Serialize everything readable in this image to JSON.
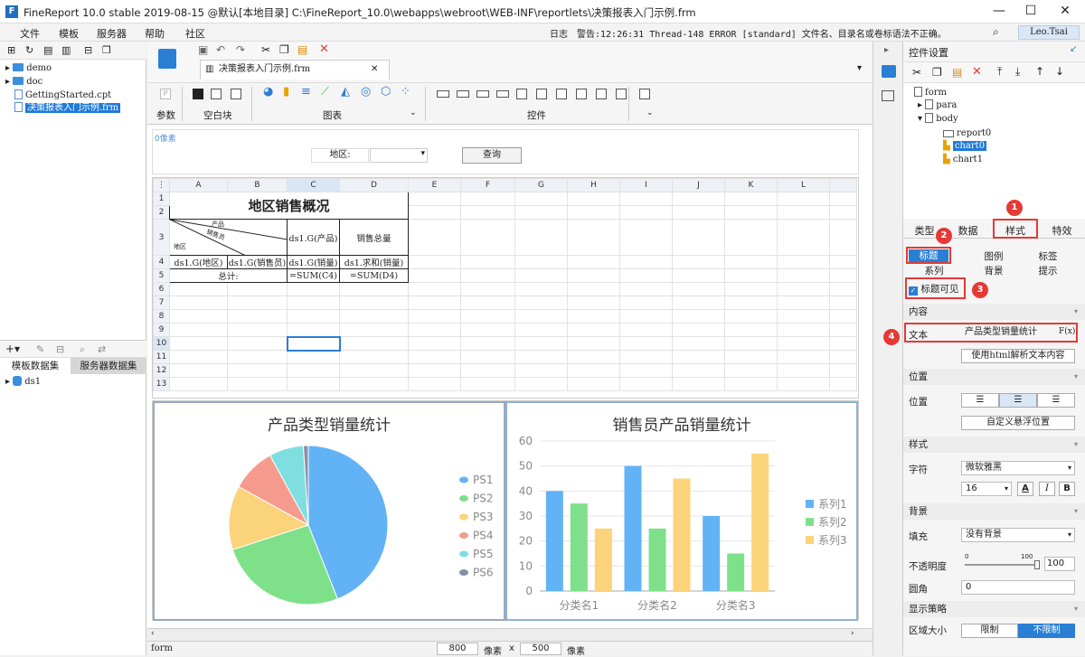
{
  "window": {
    "title": "FineReport 10.0 stable 2019-08-15 @默认[本地目录]     C:\\FineReport_10.0\\webapps\\webroot\\WEB-INF\\reportlets\\决策报表入门示例.frm",
    "minimize": "—",
    "maximize": "☐",
    "close": "✕"
  },
  "menu": {
    "items": [
      "文件",
      "模板",
      "服务器",
      "帮助",
      "社区"
    ],
    "log_label": "日志",
    "log_message": "警告:12:26:31 Thread-148 ERROR [standard] 文件名、目录名或卷标语法不正确。",
    "user": "Leo.Tsai"
  },
  "file_tree": {
    "items": [
      "demo",
      "doc",
      "GettingStarted.cpt",
      "决策报表入门示例.frm"
    ]
  },
  "datasets": {
    "tabs": [
      "模板数据集",
      "服务器数据集"
    ],
    "items": [
      "ds1"
    ]
  },
  "editor": {
    "file_tab": "决策报表入门示例.frm",
    "groups": [
      "参数",
      "空白块",
      "图表",
      "控件"
    ],
    "param_hint": "0像素",
    "param_label": "地区:",
    "query_button": "查询"
  },
  "sheet": {
    "col_headers": [
      "A",
      "B",
      "C",
      "D",
      "E",
      "F",
      "G",
      "H",
      "I",
      "J",
      "K",
      "L"
    ],
    "row_headers": [
      "1",
      "2",
      "3",
      "4",
      "5",
      "6",
      "7",
      "8",
      "9",
      "10",
      "11",
      "12",
      "13"
    ],
    "title": "地区销售概况",
    "corner_product": "产品",
    "corner_seller": "销售员",
    "corner_region": "地区",
    "c3": "ds1.G(产品)",
    "d3": "销售总量",
    "a4": "ds1.G(地区)",
    "b4": "ds1.G(销售员)",
    "c4": "ds1.G(销量)",
    "d4": "ds1.求和(销量)",
    "ab5": "总计:",
    "c5": "=SUM(C4)",
    "d5": "=SUM(D4)"
  },
  "chart_data": [
    {
      "type": "pie",
      "title": "产品类型销量统计",
      "categories": [
        "PS1",
        "PS2",
        "PS3",
        "PS4",
        "PS5",
        "PS6"
      ],
      "values": [
        44,
        26,
        13,
        9,
        7,
        1
      ],
      "colors": [
        "#62b3f5",
        "#7fe08a",
        "#fbd37a",
        "#f59b8e",
        "#7fdedf",
        "#8a8ea8"
      ]
    },
    {
      "type": "bar",
      "title": "销售员产品销量统计",
      "categories": [
        "分类名1",
        "分类名2",
        "分类名3"
      ],
      "ylim": [
        0,
        60
      ],
      "yticks": [
        "0",
        "10",
        "20",
        "30",
        "40",
        "50",
        "60"
      ],
      "series": [
        {
          "name": "系列1",
          "values": [
            40,
            50,
            30
          ],
          "color": "#62b3f5"
        },
        {
          "name": "系列2",
          "values": [
            35,
            25,
            15
          ],
          "color": "#7fe08a"
        },
        {
          "name": "系列3",
          "values": [
            25,
            45,
            55
          ],
          "color": "#fbd37a"
        }
      ]
    }
  ],
  "status": {
    "mode": "form",
    "width": "800",
    "unit1": "像素",
    "x": "x",
    "height": "500",
    "unit2": "像素"
  },
  "right_panel": {
    "title": "控件设置",
    "widget_tree": [
      "form",
      "para",
      "body",
      "report0",
      "chart0",
      "chart1"
    ],
    "main_tabs": [
      "类型",
      "数据",
      "样式",
      "特效"
    ],
    "sub_tabs": [
      "标题",
      "图例",
      "标签",
      "系列",
      "背景",
      "提示"
    ],
    "title_visible": "标题可见",
    "content_header": "内容",
    "text_label": "文本",
    "text_value": "产品类型销量统计",
    "fx": "F(x)",
    "html_button": "使用html解析文本内容",
    "position_header": "位置",
    "position_label": "位置",
    "custom_float": "自定义悬浮位置",
    "style_header": "样式",
    "font_label": "字符",
    "font_value": "微软雅黑",
    "font_size": "16",
    "bold": "A",
    "italic": "I",
    "bold2": "B",
    "bg_header": "背景",
    "fill_label": "填充",
    "fill_value": "没有背景",
    "opacity_label": "不透明度",
    "opacity_min": "0",
    "opacity_max": "100",
    "opacity_value": "100",
    "radius_label": "圆角",
    "radius_value": "0",
    "display_header": "显示策略",
    "area_label": "区域大小",
    "limit": "限制",
    "no_limit": "不限制",
    "badges": [
      "1",
      "2",
      "3",
      "4"
    ]
  }
}
